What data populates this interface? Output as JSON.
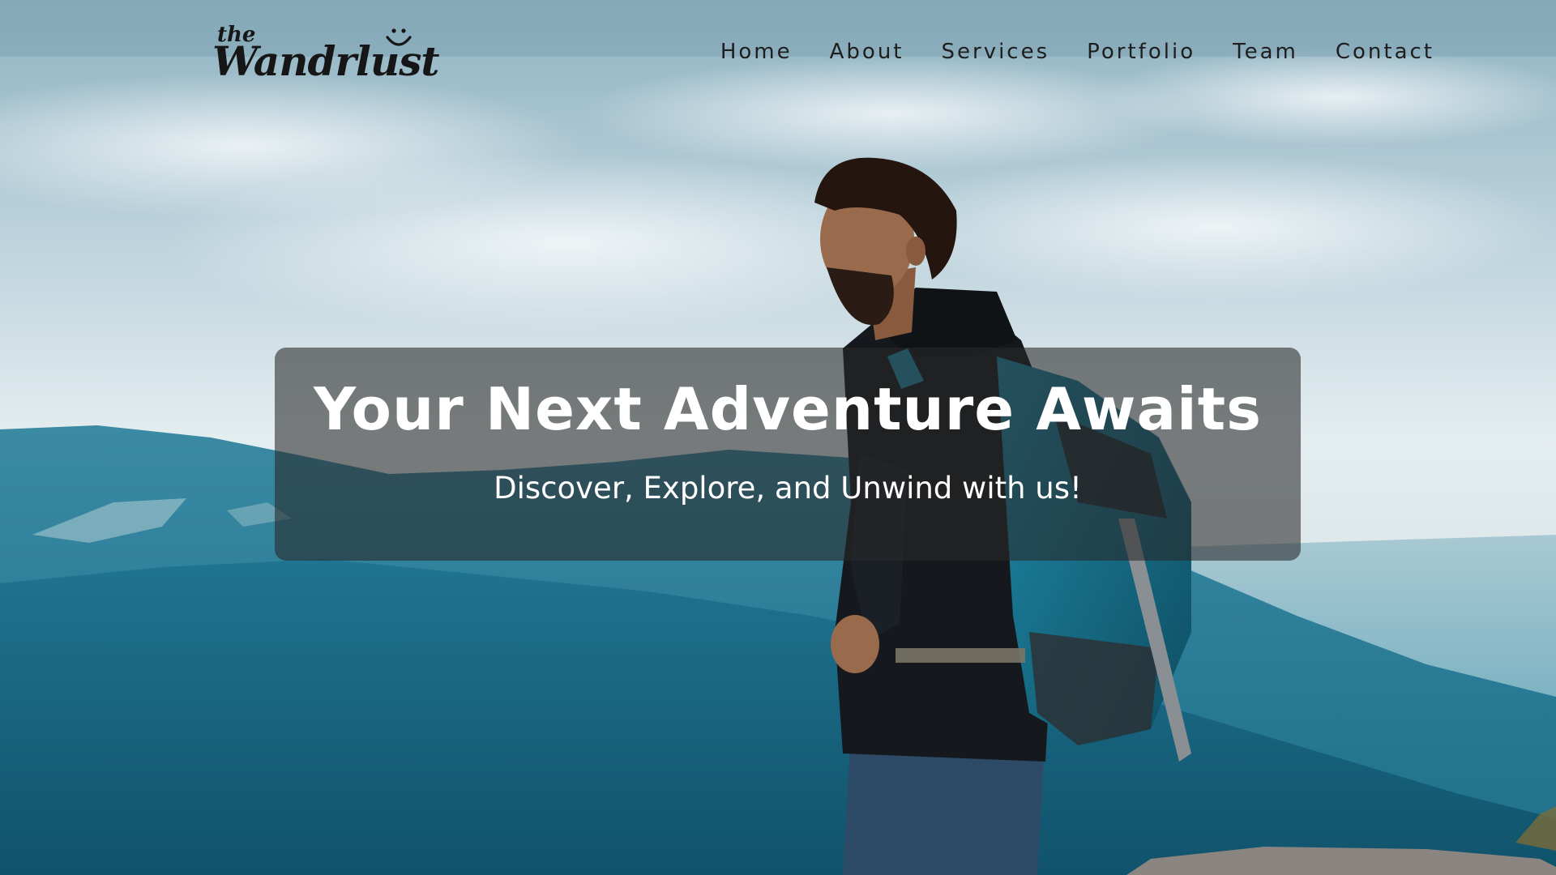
{
  "brand": {
    "prefix": "the",
    "name": "Wandrlust",
    "logo_icon": "smile-icon"
  },
  "nav": {
    "items": [
      {
        "label": "Home"
      },
      {
        "label": "About"
      },
      {
        "label": "Services"
      },
      {
        "label": "Portfolio"
      },
      {
        "label": "Team"
      },
      {
        "label": "Contact"
      }
    ]
  },
  "hero": {
    "title": "Your Next Adventure Awaits",
    "subtitle": "Discover, Explore, and Unwind with us!",
    "background_image": "hiker-with-backpack-on-mountain"
  },
  "colors": {
    "text_dark": "#1e1e1e",
    "sky": "#cfe0e8",
    "mountains": "#1f7a94",
    "box_overlay": "#282828"
  }
}
